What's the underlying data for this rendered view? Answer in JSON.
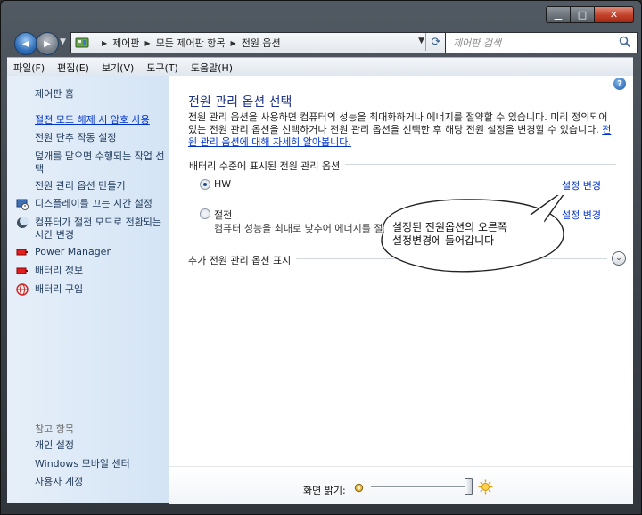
{
  "window": {
    "buttons": {
      "minimize": "▁",
      "maximize": "□",
      "close": "✕"
    }
  },
  "nav": {
    "back_glyph": "◀",
    "forward_glyph": "▶",
    "breadcrumb": [
      "제어판",
      "모든 제어판 항목",
      "전원 옵션"
    ],
    "separator": "▶",
    "refresh_glyph": "⟳",
    "dropdown_glyph": "▼",
    "search_placeholder": "제어판 검색"
  },
  "menu": [
    "파일(F)",
    "편집(E)",
    "보기(V)",
    "도구(T)",
    "도움말(H)"
  ],
  "sidebar": {
    "home": "제어판 홈",
    "items": [
      {
        "label": "절전 모드 해제 시 암호 사용",
        "link": true
      },
      {
        "label": "전원 단추 작동 설정",
        "link": false
      },
      {
        "label": "덮개를 닫으면 수행되는 작업 선택",
        "link": false
      },
      {
        "label": "전원 관리 옵션 만들기",
        "link": false
      },
      {
        "label": "디스플레이를 끄는 시간 설정",
        "icon": "display-timer-icon"
      },
      {
        "label": "컴퓨터가 절전 모드로 전환되는 시간 변경",
        "icon": "moon-sleep-icon"
      },
      {
        "label": "Power Manager",
        "icon": "battery-icon"
      },
      {
        "label": "배터리 정보",
        "icon": "battery-icon"
      },
      {
        "label": "배터리 구입",
        "icon": "globe-icon"
      }
    ],
    "see_also": "참고 항목",
    "see_also_items": [
      "개인 설정",
      "Windows 모바일 센터",
      "사용자 계정"
    ]
  },
  "main": {
    "help_glyph": "?",
    "title": "전원 관리 옵션 선택",
    "intro_text": "전원 관리 옵션을 사용하면 컴퓨터의 성능을 최대화하거나 에너지를 절약할 수 있습니다. 미리 정의되어 있는 전원 관리 옵션을 선택하거나 전원 관리 옵션을 선택한 후 해당 전원 설정을 변경할 수 있습니다.",
    "intro_link": "전원 관리 옵션에 대해 자세히 알아봅니다.",
    "group_heading": "배터리 수준에 표시된 전원 관리 옵션",
    "plans": [
      {
        "name": "HW",
        "selected": true,
        "description": "",
        "change_label": "설정 변경"
      },
      {
        "name": "절전",
        "selected": false,
        "description": "컴퓨터 성능을 최대로 낮추어 에너지를 절약합니다.",
        "change_label": "설정 변경"
      }
    ],
    "more_heading": "추가 전원 관리 옵션 표시",
    "expand_glyph": "⌄"
  },
  "annotation": {
    "line1": "설정된 전원옵션의 오른쪽",
    "line2": "설정변경에 들어갑니다"
  },
  "footer": {
    "brightness_label": "화면 밝기:",
    "brightness_level": 1.0
  },
  "colors": {
    "link": "#0033cc",
    "title": "#1e3287",
    "sidebar_text": "#1e395b"
  }
}
